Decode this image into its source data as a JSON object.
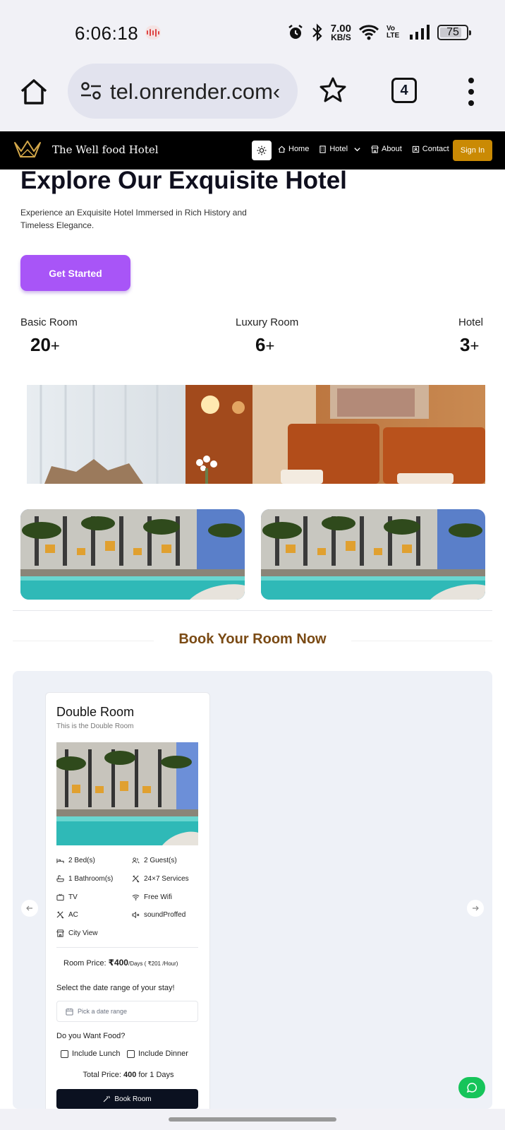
{
  "status_bar": {
    "time": "6:06:18",
    "network_speed_value": "7.00",
    "network_speed_unit": "KB/S",
    "volte": "Vo LTE",
    "battery": "75"
  },
  "browser": {
    "url": "hotel.onrender.com",
    "url_visible": "›tel.onrender.com",
    "tab_count": "4"
  },
  "nav": {
    "logo_text": "The Well food Hotel",
    "links": [
      {
        "label": "Home",
        "icon": "home-icon"
      },
      {
        "label": "Hotel",
        "icon": "hotel-icon"
      },
      {
        "label": "About",
        "icon": "store-icon"
      },
      {
        "label": "Contact",
        "icon": "contact-icon"
      }
    ],
    "signin_label": "Sign In",
    "accent_color": "#ca8a04"
  },
  "hero": {
    "title": "Explore Our Exquisite Hotel",
    "subtitle": "Experience an Exquisite Hotel Immersed in Rich History and Timeless Elegance.",
    "cta_label": "Get Started",
    "cta_color": "#a855f7",
    "stats": [
      {
        "label": "Basic Room",
        "value": "20",
        "suffix": "+"
      },
      {
        "label": "Luxury Room",
        "value": "6",
        "suffix": "+"
      },
      {
        "label": "Hotel",
        "value": "3",
        "suffix": "+"
      }
    ]
  },
  "booking": {
    "section_title": "Book Your Room Now",
    "prev_icon": "arrow-left-icon",
    "next_icon": "arrow-right-icon",
    "card": {
      "title": "Double Room",
      "subtitle": "This is the Double Room",
      "features": [
        {
          "label": "2 Bed(s)",
          "icon": "bed-icon"
        },
        {
          "label": "2 Guest(s)",
          "icon": "users-icon"
        },
        {
          "label": "1 Bathroom(s)",
          "icon": "bath-icon"
        },
        {
          "label": "24×7 Services",
          "icon": "utensils-icon"
        },
        {
          "label": "TV",
          "icon": "tv-icon"
        },
        {
          "label": "Free Wifi",
          "icon": "wifi-icon"
        },
        {
          "label": "AC",
          "icon": "ac-icon"
        },
        {
          "label": "soundProffed",
          "icon": "mute-icon"
        },
        {
          "label": "City View",
          "icon": "city-icon"
        }
      ],
      "price_label": "Room Price:",
      "price_value": "₹400",
      "price_unit": "/Days ( ₹201 /Hour)",
      "date_question": "Select the date range of your stay!",
      "date_placeholder": "Pick a date range",
      "food_question": "Do you Want Food?",
      "include_lunch": "Include Lunch",
      "include_dinner": "Include Dinner",
      "total_prefix": "Total Price:",
      "total_value": "400",
      "total_suffix": "for 1 Days",
      "book_label": "Book Room"
    }
  }
}
